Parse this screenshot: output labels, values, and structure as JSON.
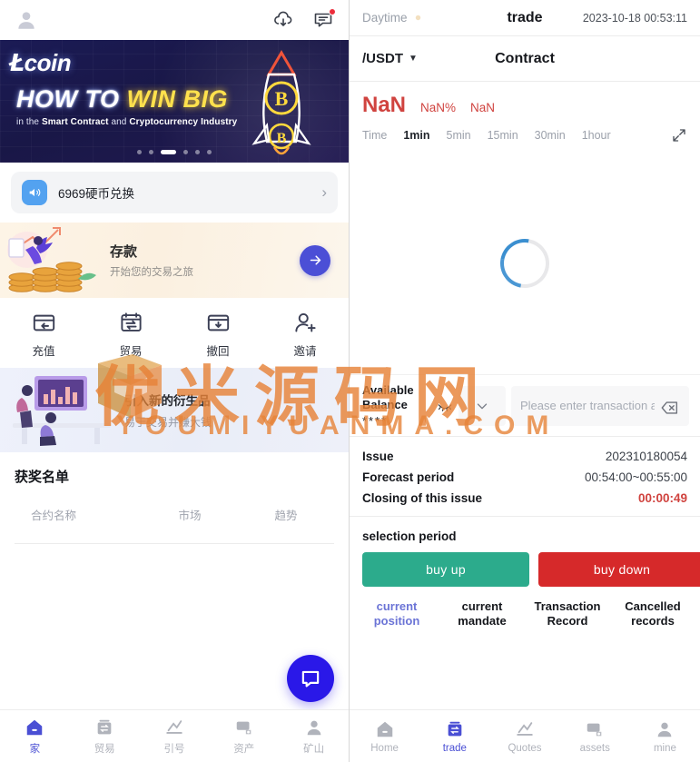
{
  "left": {
    "topbar": {
      "avatar_icon": "user-avatar-icon",
      "download_icon": "cloud-download-icon",
      "message_icon": "chat-message-icon",
      "has_unread": true
    },
    "hero": {
      "logo": "coin",
      "title_line1_a": "HOW TO ",
      "title_line1_b": "WIN BIG",
      "subtitle_prefix": "in the ",
      "subtitle_bold1": "Smart Contract",
      "subtitle_mid": " and ",
      "subtitle_bold2": "Cryptocurrency Industry",
      "dots_total": 6,
      "dots_active_index": 2
    },
    "notice": {
      "icon": "speaker-announcement-icon",
      "text": "6969硬币兑换",
      "chevron": "chevron-right-icon"
    },
    "deposit": {
      "title": "存款",
      "subtitle": "开始您的交易之旅",
      "go_icon": "arrow-right-icon"
    },
    "quick_actions": [
      {
        "label": "充值",
        "icon": "recharge-card-icon"
      },
      {
        "label": "贸易",
        "icon": "trade-exchange-icon"
      },
      {
        "label": "撤回",
        "icon": "withdraw-download-icon"
      },
      {
        "label": "邀请",
        "icon": "invite-user-plus-icon"
      }
    ],
    "promo": {
      "title": "引入新的衍生品",
      "subtitle": "易于交易并赚大钱"
    },
    "winners": {
      "title": "获奖名单",
      "columns": [
        "合约名称",
        "市场",
        "趋势"
      ],
      "rows": []
    },
    "fab": {
      "icon": "chat-bubble-icon"
    },
    "bottom_nav": [
      {
        "label": "家",
        "icon": "home-icon",
        "active": true
      },
      {
        "label": "贸易",
        "icon": "trade-icon",
        "active": false
      },
      {
        "label": "引号",
        "icon": "quotes-chart-icon",
        "active": false
      },
      {
        "label": "资产",
        "icon": "assets-wallet-icon",
        "active": false
      },
      {
        "label": "矿山",
        "icon": "mine-user-icon",
        "active": false
      }
    ]
  },
  "right": {
    "topbar": {
      "theme_label": "Daytime",
      "theme_icon": "sun-icon",
      "title": "trade",
      "clock": "2023-10-18 00:53:11"
    },
    "pair_bar": {
      "pair": "/USDT",
      "caret_icon": "caret-down-icon",
      "title": "Contract"
    },
    "price": {
      "last": "NaN",
      "change_percent": "NaN%",
      "change_abs": "NaN",
      "color": "#d0433f"
    },
    "timeframes": [
      {
        "label": "Time",
        "active": false
      },
      {
        "label": "1min",
        "active": true
      },
      {
        "label": "5min",
        "active": false
      },
      {
        "label": "15min",
        "active": false
      },
      {
        "label": "30min",
        "active": false
      },
      {
        "label": "1hour",
        "active": false
      }
    ],
    "expand_icon": "fullscreen-expand-icon",
    "chart": {
      "state": "loading",
      "spinner_icon": "loading-spinner-icon"
    },
    "balance": {
      "label": "Available Balance",
      "value": "****",
      "eye_icon": "eye-off-icon",
      "select_icon": "chevron-down-icon",
      "amount_placeholder": "Please enter transaction amount",
      "amount_value": "",
      "backspace_icon": "backspace-delete-icon"
    },
    "info": [
      {
        "key": "Issue",
        "value": "202310180054",
        "warn": false
      },
      {
        "key": "Forecast period",
        "value": "00:54:00~00:55:00",
        "warn": false
      },
      {
        "key": "Closing of this issue",
        "value": "00:00:49",
        "warn": true
      }
    ],
    "selection_period_label": "selection period",
    "buttons": {
      "buy_up": "buy up",
      "buy_up_color": "#2cab8c",
      "buy_down": "buy down",
      "buy_down_color": "#d6292a"
    },
    "record_tabs": [
      {
        "label_1": "current",
        "label_2": "position",
        "active": true
      },
      {
        "label_1": "current",
        "label_2": "mandate",
        "active": false
      },
      {
        "label_1": "Transaction",
        "label_2": "Record",
        "active": false
      },
      {
        "label_1": "Cancelled",
        "label_2": "records",
        "active": false
      }
    ],
    "bottom_nav": [
      {
        "label": "Home",
        "icon": "home-icon",
        "active": false
      },
      {
        "label": "trade",
        "icon": "trade-icon",
        "active": true
      },
      {
        "label": "Quotes",
        "icon": "quotes-chart-icon",
        "active": false
      },
      {
        "label": "assets",
        "icon": "assets-wallet-icon",
        "active": false
      },
      {
        "label": "mine",
        "icon": "mine-user-icon",
        "active": false
      }
    ]
  },
  "watermark": {
    "cn": "优米源码网",
    "en": "YOUMIYUANMA.COM",
    "color": "#e68338"
  }
}
